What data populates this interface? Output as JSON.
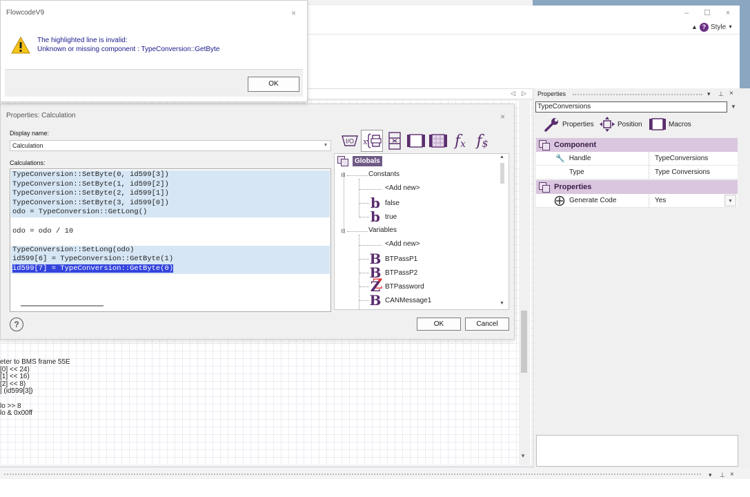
{
  "flowcode_dialog": {
    "title": "FlowcodeV9",
    "close": "×",
    "message_line1": "The highlighted line is invalid:",
    "message_line2": "Unknown or missing component : TypeConversion::GetByte",
    "ok_label": "OK"
  },
  "app": {
    "window_buttons": [
      "–",
      "☐",
      "×"
    ],
    "style_label": "Style",
    "tab_nav": [
      "◁",
      "▷"
    ]
  },
  "calc_dialog": {
    "title": "Properties: Calculation",
    "close": "×",
    "display_name_label": "Display name:",
    "display_name_value": "Calculation",
    "calculations_label": "Calculations:",
    "code_lines": [
      {
        "text": "TypeConversion::SetByte(0, id599[3])",
        "state": "highlight"
      },
      {
        "text": "TypeConversion::SetByte(1, id599[2])",
        "state": "highlight"
      },
      {
        "text": "TypeConversion::SetByte(2, id599[1])",
        "state": "highlight"
      },
      {
        "text": "TypeConversion::SetByte(3, id599[0])",
        "state": "highlight"
      },
      {
        "text": "odo = TypeConversion::GetLong()",
        "state": "highlight"
      },
      {
        "text": "",
        "state": "normal"
      },
      {
        "text": "odo = odo / 10",
        "state": "normal"
      },
      {
        "text": "",
        "state": "normal"
      },
      {
        "text": "TypeConversion::SetLong(odo)",
        "state": "highlight"
      },
      {
        "text": "id599[6] = TypeConversion::GetByte(1)",
        "state": "highlight"
      },
      {
        "text": "id599[7] = TypeConversion::GetByte(0)",
        "state": "selected"
      }
    ],
    "toolbar_icons": [
      "io-icon",
      "variable-icon",
      "component-icon",
      "port-icon",
      "macro-icon",
      "function-icon",
      "string-function-icon"
    ],
    "toolbar_io": "I/O",
    "ok_label": "OK",
    "cancel_label": "Cancel",
    "help_label": "?"
  },
  "tree": {
    "root": "Globals",
    "constants_label": "Constants",
    "constants_add": "<Add new>",
    "constants": [
      {
        "name": "false",
        "glyph": "b"
      },
      {
        "name": "true",
        "glyph": "b"
      }
    ],
    "variables_label": "Variables",
    "variables_add": "<Add new>",
    "variables": [
      {
        "name": "BTPassP1",
        "glyph": "B"
      },
      {
        "name": "BTPassP2",
        "glyph": "B"
      },
      {
        "name": "BTPassword",
        "glyph": "Z"
      },
      {
        "name": "CANMessage1",
        "glyph": "B"
      }
    ]
  },
  "canvas_text": [
    "eter to BMS frame 55E",
    "[0] << 24)",
    "[1] << 16)",
    "[2] << 8)",
    "| (id599[3])",
    "",
    "lo >> 8",
    "lo & 0x00ff"
  ],
  "properties_panel": {
    "title": "Properties",
    "selected_component": "TypeConversions",
    "tabs": [
      "Properties",
      "Position",
      "Macros"
    ],
    "groups": [
      {
        "name": "Component",
        "rows": [
          {
            "key": "Handle",
            "value": "TypeConversions"
          },
          {
            "key": "Type",
            "value": "Type Conversions"
          }
        ]
      },
      {
        "name": "Properties",
        "rows": [
          {
            "key": "Generate Code",
            "value": "Yes"
          }
        ]
      }
    ]
  },
  "colors": {
    "accent_purple": "#5a2d6e",
    "group_header": "#dac6df",
    "code_highlight": "#d6e6f4",
    "code_selection": "#3344dd"
  }
}
